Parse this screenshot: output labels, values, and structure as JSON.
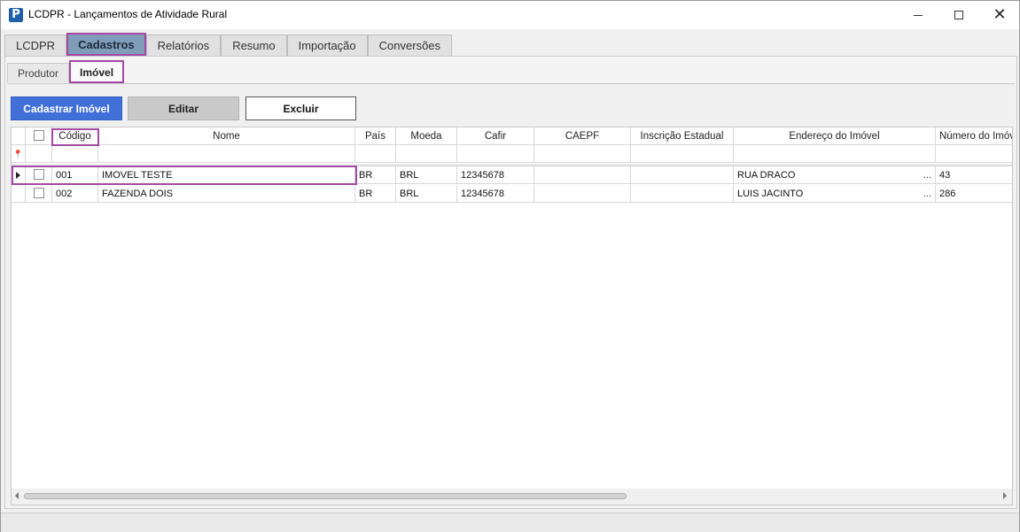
{
  "window": {
    "title": "LCDPR - Lançamentos de Atividade Rural",
    "app_icon_glyph": "P"
  },
  "main_tabs": [
    {
      "label": "LCDPR",
      "active": false
    },
    {
      "label": "Cadastros",
      "active": true
    },
    {
      "label": "Relatórios",
      "active": false
    },
    {
      "label": "Resumo",
      "active": false
    },
    {
      "label": "Importação",
      "active": false
    },
    {
      "label": "Conversões",
      "active": false
    }
  ],
  "sub_tabs": [
    {
      "label": "Produtor",
      "active": false
    },
    {
      "label": "Imóvel",
      "active": true
    }
  ],
  "toolbar": {
    "add_label": "Cadastrar Imóvel",
    "edit_label": "Editar",
    "delete_label": "Excluir"
  },
  "grid": {
    "columns": [
      "Código",
      "Nome",
      "País",
      "Moeda",
      "Cafir",
      "CAEPF",
      "Inscrição Estadual",
      "Endereço do Imóvel",
      "Número do Imóvel"
    ],
    "rows": [
      {
        "codigo": "001",
        "nome": "IMOVEL TESTE",
        "pais": "BR",
        "moeda": "BRL",
        "cafir": "12345678",
        "caepf": "",
        "ie": "",
        "endereco": "RUA DRACO",
        "numero": "43",
        "selected": true
      },
      {
        "codigo": "002",
        "nome": "FAZENDA DOIS",
        "pais": "BR",
        "moeda": "BRL",
        "cafir": "12345678",
        "caepf": "",
        "ie": "",
        "endereco": "LUIS JACINTO",
        "numero": "286",
        "selected": false
      }
    ],
    "ellipsis": "..."
  },
  "icons": {
    "pin": "pin-icon",
    "row_indicator": "row-indicator-icon",
    "close": "close-icon",
    "minimize": "minimize-icon",
    "maximize": "maximize-icon"
  },
  "colors": {
    "highlight": "#a349a4",
    "primary_button": "#4170d9",
    "active_tab": "#7f9db9"
  }
}
